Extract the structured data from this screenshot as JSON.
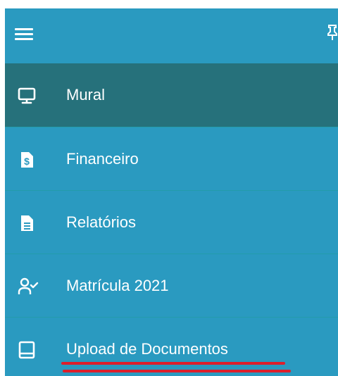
{
  "topbar": {
    "menu_icon": "hamburger-icon",
    "right_icon": "pin-icon"
  },
  "menu": {
    "items": [
      {
        "label": "Mural",
        "icon": "monitor-icon",
        "active": true
      },
      {
        "label": "Financeiro",
        "icon": "dollar-document-icon",
        "active": false
      },
      {
        "label": "Relatórios",
        "icon": "report-document-icon",
        "active": false
      },
      {
        "label": "Matrícula 2021",
        "icon": "user-check-icon",
        "active": false
      },
      {
        "label": "Upload de Documentos",
        "icon": "book-icon",
        "active": false
      }
    ]
  },
  "colors": {
    "sidebar_bg": "#2a9ac0",
    "active_bg": "#26717b",
    "divider": "#239cab",
    "text": "#ffffff",
    "annotation_underline": "#dd1f2b"
  }
}
